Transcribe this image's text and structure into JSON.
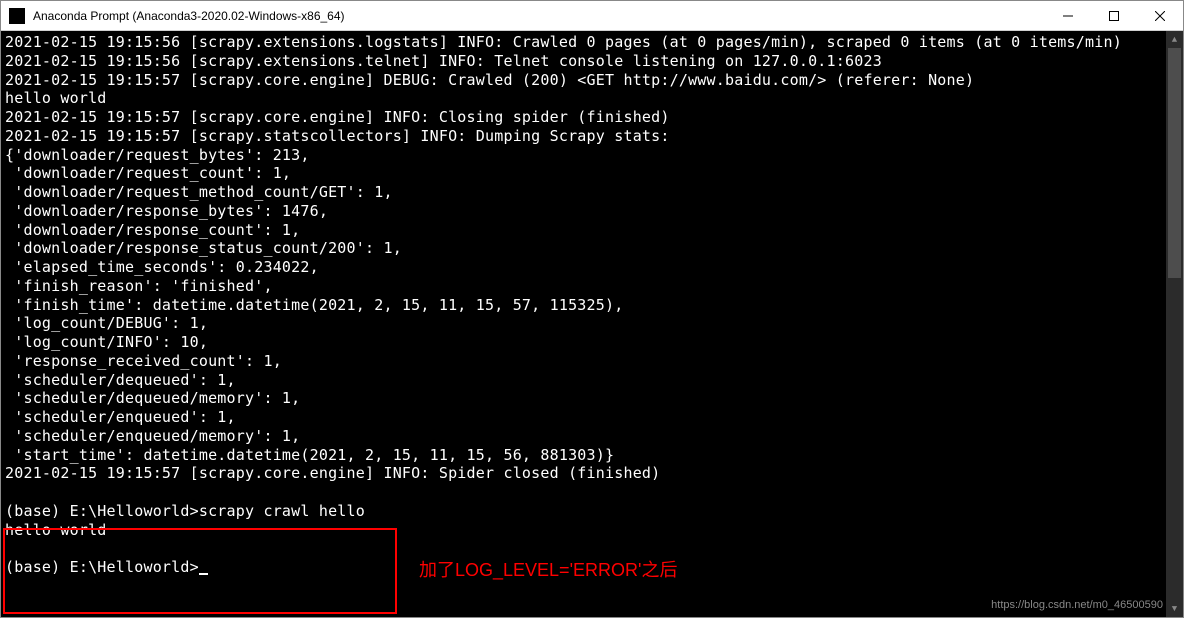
{
  "titlebar": {
    "title": "Anaconda Prompt (Anaconda3-2020.02-Windows-x86_64)"
  },
  "terminal": {
    "lines": [
      "2021-02-15 19:15:56 [scrapy.extensions.logstats] INFO: Crawled 0 pages (at 0 pages/min), scraped 0 items (at 0 items/min)",
      "2021-02-15 19:15:56 [scrapy.extensions.telnet] INFO: Telnet console listening on 127.0.0.1:6023",
      "2021-02-15 19:15:57 [scrapy.core.engine] DEBUG: Crawled (200) <GET http://www.baidu.com/> (referer: None)",
      "hello world",
      "2021-02-15 19:15:57 [scrapy.core.engine] INFO: Closing spider (finished)",
      "2021-02-15 19:15:57 [scrapy.statscollectors] INFO: Dumping Scrapy stats:",
      "{'downloader/request_bytes': 213,",
      " 'downloader/request_count': 1,",
      " 'downloader/request_method_count/GET': 1,",
      " 'downloader/response_bytes': 1476,",
      " 'downloader/response_count': 1,",
      " 'downloader/response_status_count/200': 1,",
      " 'elapsed_time_seconds': 0.234022,",
      " 'finish_reason': 'finished',",
      " 'finish_time': datetime.datetime(2021, 2, 15, 11, 15, 57, 115325),",
      " 'log_count/DEBUG': 1,",
      " 'log_count/INFO': 10,",
      " 'response_received_count': 1,",
      " 'scheduler/dequeued': 1,",
      " 'scheduler/dequeued/memory': 1,",
      " 'scheduler/enqueued': 1,",
      " 'scheduler/enqueued/memory': 1,",
      " 'start_time': datetime.datetime(2021, 2, 15, 11, 15, 56, 881303)}",
      "2021-02-15 19:15:57 [scrapy.core.engine] INFO: Spider closed (finished)",
      "",
      "(base) E:\\Helloworld>scrapy crawl hello",
      "hello world",
      "",
      "(base) E:\\Helloworld>"
    ]
  },
  "annotation": {
    "text": "加了LOG_LEVEL='ERROR'之后"
  },
  "watermark": {
    "text": "https://blog.csdn.net/m0_46500590"
  }
}
